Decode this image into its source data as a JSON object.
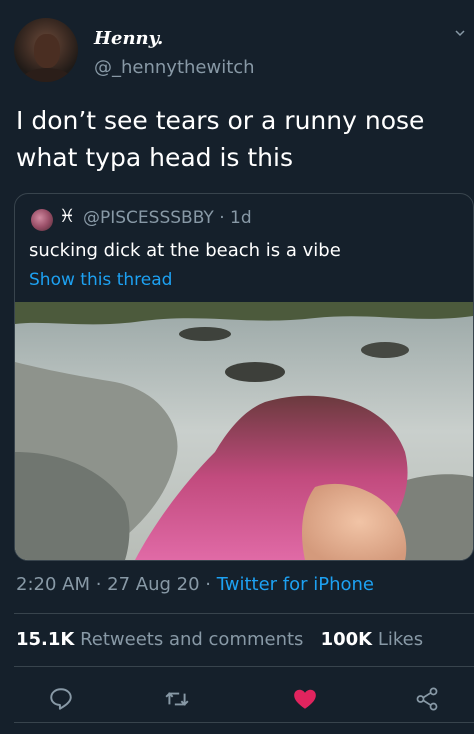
{
  "tweet": {
    "display_name": "Henny.",
    "handle": "@_hennythewitch",
    "text": "I don’t see tears or a runny nose\nwhat typa head is this",
    "timestamp": "2:20 AM · 27 Aug 20 · ",
    "client": "Twitter for iPhone"
  },
  "quoted_tweet": {
    "symbol": "♓",
    "handle_time": "@PISCESSSBBY · 1d",
    "text": "sucking dick at the beach is a vibe",
    "show_thread": "Show this thread"
  },
  "stats": {
    "retweets_count": "15.1K",
    "retweets_label": "Retweets and comments",
    "likes_count": "100K",
    "likes_label": "Likes"
  },
  "actions": {
    "reply_icon": "reply-icon",
    "retweet_icon": "retweet-icon",
    "like_icon": "heart-icon",
    "share_icon": "share-icon"
  },
  "colors": {
    "background": "#15202b",
    "secondary_text": "#8899a6",
    "link": "#1da1f2",
    "like": "#e0245e",
    "border": "#38444d"
  }
}
